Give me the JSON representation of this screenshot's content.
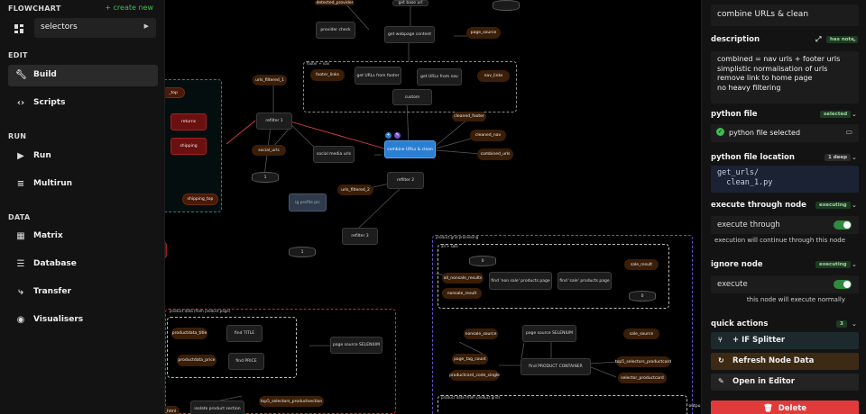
{
  "sidebar": {
    "flowchart_label": "FLOWCHART",
    "create_new": "+ create new",
    "flow_selected": "selectors",
    "edit_label": "EDIT",
    "run_label": "RUN",
    "data_label": "DATA",
    "items": {
      "build": "Build",
      "scripts": "Scripts",
      "run": "Run",
      "multirun": "Multirun",
      "matrix": "Matrix",
      "database": "Database",
      "transfer": "Transfer",
      "visualisers": "Visualisers"
    }
  },
  "canvas": {
    "nodes": {
      "detected_provider": "detected_provider",
      "get_base_url": "get base url",
      "provider_check": "provider check",
      "get_webpage_content": "get webpage content",
      "page_source_top": "page_source",
      "footer_nav_group": "footer + nav",
      "footer_links": "footer_links",
      "get_urls_footer": "get URLs from footer",
      "get_urls_nav": "get URLs from nav",
      "nav_links": "nav_links",
      "custom": "custom",
      "urls_filtered_1": "urls_filtered_1",
      "cleaned_footer": "cleaned_footer",
      "cleaned_nav": "cleaned_nav",
      "refilter_1": "refilter 1",
      "combine_urls_node": "combine URLs & clean",
      "combined_urls": "combined_urls",
      "social_urls": "social_urls",
      "social_media_urls": "social media urls",
      "refilter_2": "refilter 2",
      "urls_filtered_2": "urls_filtered_2",
      "ig_profile_pic": "ig profile pic",
      "refilter_3": "refilter 3",
      "cyl_1a": "1",
      "cyl_1b": "1",
      "returns": "returns",
      "shipping": "shipping",
      "shipping_top": "shipping_top",
      "top_partial": "_top",
      "product_grid_group": "product grid processing",
      "all_sale_group": "all + sale",
      "cyl_0a": "0",
      "cyl_0b": "0",
      "sale_result": "sale_result",
      "all_nonsale_results": "all_nonsale_results",
      "find_non_sale": "find 'non sale' products page",
      "find_sale": "find 'sale' products page",
      "nonsale_result": "nonsale_result",
      "product_data_page_group": "product data (from product page)",
      "productdata_title": "productdata_title",
      "find_title": "find TITLE",
      "productdata_price": "productdata_price",
      "find_price": "find PRICE",
      "page_source_selenium_1": "page source SELENIUM",
      "nonsale_source": "nonsale_source",
      "page_source_selenium_2": "page source SELENIUM",
      "sale_source": "sale_source",
      "page_tag_count": "page_tag_count",
      "find_product_container": "find PRODUCT CONTAINER",
      "top5_selectors_productcard": "top5_selectors_productcard",
      "productcard_code_single": "productcard_code_single",
      "selector_productcard": "selector_productcard",
      "product_data_grid_group": "product data (from product grid)",
      "top5_selectors_productsection": "top5_selectors_productsection",
      "isolate_product_section": "isolate product section",
      "row_html_partial": "w_html",
      "output_partial": "outpu"
    }
  },
  "panel": {
    "node_title": "combine URLs & clean",
    "description_label": "description",
    "description_badge": "has note",
    "description_lines": [
      "combined = nav urls + footer urls",
      "simplistic normalisation of urls",
      "remove link to home page",
      "no heavy filtering"
    ],
    "python_file_label": "python file",
    "python_file_badge": "selected",
    "python_file_status": "python file selected",
    "python_file_location_label": "python file location",
    "python_file_location_badge": "1 deep",
    "python_file_path": "get_urls/\n  clean_1.py",
    "execute_through_label": "execute through node",
    "execute_through_badge": "executing",
    "execute_through_toggle": "execute through",
    "execute_through_note": "execution will continue through this node",
    "ignore_node_label": "ignore node",
    "ignore_node_badge": "executing",
    "ignore_node_toggle": "execute",
    "ignore_node_note": "this node will execute normally",
    "quick_actions_label": "quick actions",
    "quick_actions_badge": "3",
    "actions": {
      "if_splitter": "+ IF Splitter",
      "refresh": "Refresh Node Data",
      "open_editor": "Open in Editor",
      "delete": "Delete"
    }
  },
  "colors": {
    "accent_green": "#3fbf4f",
    "selected_node": "#2a7fd4",
    "delete_red": "#e03a3a",
    "refresh_bg": "#3d2a14",
    "splitter_bg": "#1c2a2e"
  }
}
